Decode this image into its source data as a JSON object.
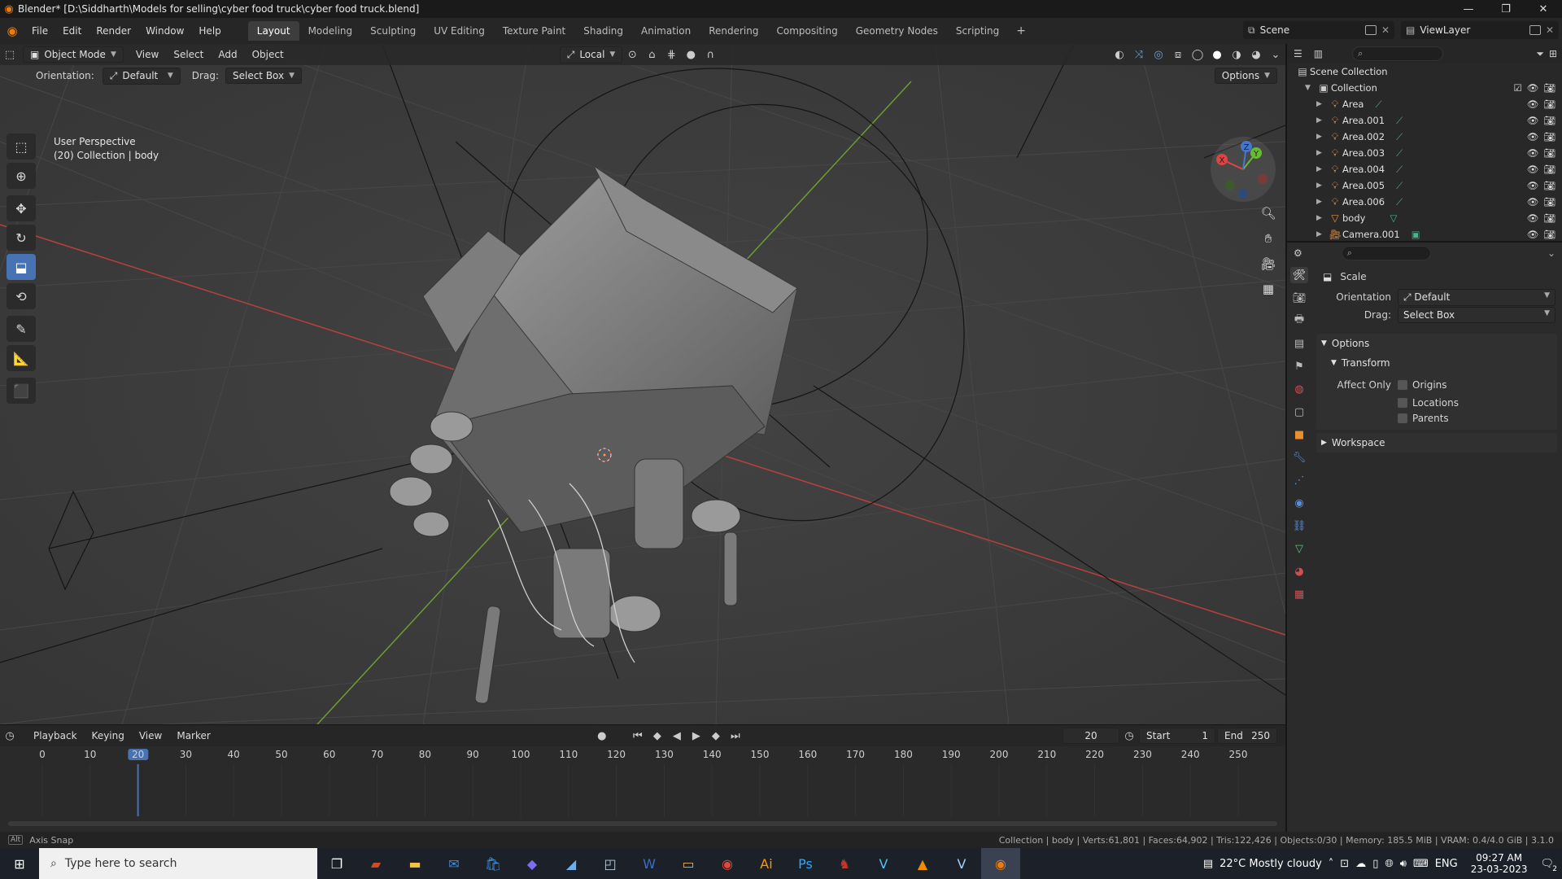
{
  "window": {
    "title": "Blender* [D:\\Siddharth\\Models for selling\\cyber food truck\\cyber food truck.blend]",
    "controls": [
      "—",
      "❐",
      "✕"
    ]
  },
  "menubar": {
    "menus": [
      "File",
      "Edit",
      "Render",
      "Window",
      "Help"
    ],
    "workspaces": [
      "Layout",
      "Modeling",
      "Sculpting",
      "UV Editing",
      "Texture Paint",
      "Shading",
      "Animation",
      "Rendering",
      "Compositing",
      "Geometry Nodes",
      "Scripting"
    ],
    "active_workspace": "Layout",
    "scene": "Scene",
    "view_layer": "ViewLayer"
  },
  "viewport": {
    "mode": "Object Mode",
    "menus": [
      "View",
      "Select",
      "Add",
      "Object"
    ],
    "transform_orientation": "Local",
    "orientation_label": "Orientation:",
    "orientation_value": "Default",
    "drag_label": "Drag:",
    "drag_value": "Select Box",
    "options_label": "Options",
    "info_line1": "User Perspective",
    "info_line2": "(20) Collection | body",
    "tools": [
      "select-box",
      "cursor",
      "move",
      "rotate",
      "scale",
      "transform",
      "annotate",
      "measure",
      "add-cube"
    ],
    "active_tool": "scale",
    "gizmo_axes": [
      "X",
      "Y",
      "Z"
    ]
  },
  "timeline": {
    "menus": [
      "Playback",
      "Keying",
      "View",
      "Marker"
    ],
    "current_frame": "20",
    "start_label": "Start",
    "start_value": "1",
    "end_label": "End",
    "end_value": "250",
    "ticks": [
      "0",
      "10",
      "20",
      "30",
      "40",
      "50",
      "60",
      "70",
      "80",
      "90",
      "100",
      "110",
      "120",
      "130",
      "140",
      "150",
      "160",
      "170",
      "180",
      "190",
      "200",
      "210",
      "220",
      "230",
      "240",
      "250"
    ]
  },
  "statusbar": {
    "left": "Axis Snap",
    "right": "Collection | body | Verts:61,801 | Faces:64,902 | Tris:122,426 | Objects:0/30 | Memory: 185.5 MiB | VRAM: 0.4/4.0 GiB | 3.1.0"
  },
  "outliner": {
    "root": "Scene Collection",
    "collection": "Collection",
    "items": [
      {
        "name": "Area",
        "kind": "light"
      },
      {
        "name": "Area.001",
        "kind": "light"
      },
      {
        "name": "Area.002",
        "kind": "light"
      },
      {
        "name": "Area.003",
        "kind": "light"
      },
      {
        "name": "Area.004",
        "kind": "light"
      },
      {
        "name": "Area.005",
        "kind": "light"
      },
      {
        "name": "Area.006",
        "kind": "light"
      },
      {
        "name": "body",
        "kind": "mesh"
      },
      {
        "name": "Camera.001",
        "kind": "camera"
      }
    ]
  },
  "properties": {
    "tool_name": "Scale",
    "orientation_label": "Orientation",
    "orientation_value": "Default",
    "drag_label": "Drag:",
    "drag_value": "Select Box",
    "options_panel": "Options",
    "transform_panel": "Transform",
    "affect_only_label": "Affect Only",
    "checkboxes": [
      "Origins",
      "Locations",
      "Parents"
    ],
    "workspace_panel": "Workspace"
  },
  "taskbar": {
    "search_placeholder": "Type here to search",
    "weather": "22°C  Mostly cloudy",
    "language": "ENG",
    "time": "09:27 AM",
    "date": "23-03-2023",
    "notifications": "2"
  },
  "colors": {
    "accent": "#4772b3",
    "blender_orange": "#e87d0d",
    "x_axis": "#b8403f",
    "y_axis": "#6f9c2e"
  }
}
